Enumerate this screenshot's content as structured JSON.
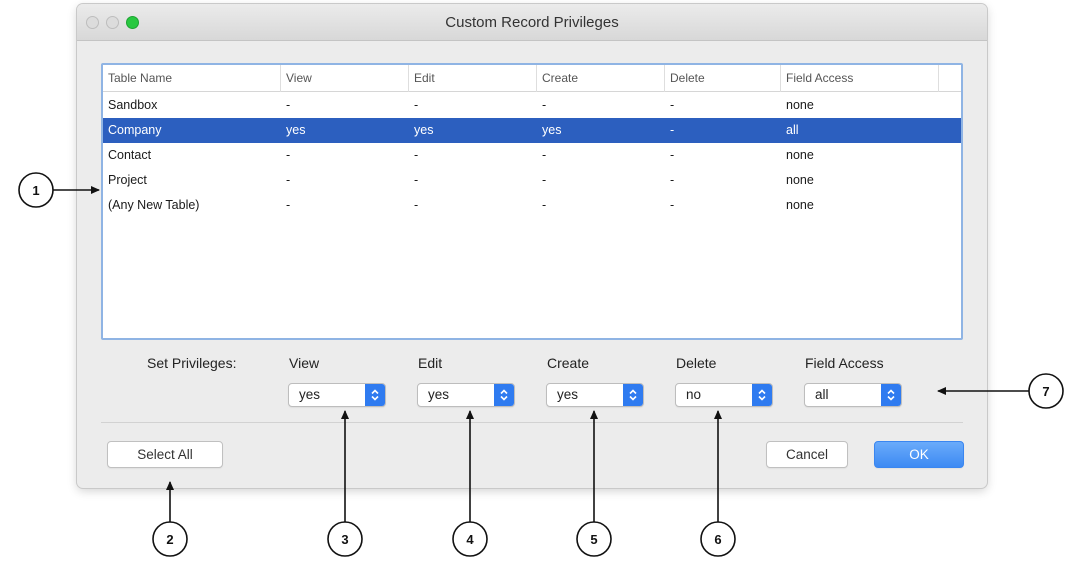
{
  "window": {
    "title": "Custom Record Privileges"
  },
  "table": {
    "columns": [
      "Table Name",
      "View",
      "Edit",
      "Create",
      "Delete",
      "Field Access"
    ],
    "rows": [
      {
        "cells": [
          "Sandbox",
          "-",
          "-",
          "-",
          "-",
          "none"
        ],
        "selected": false
      },
      {
        "cells": [
          "Company",
          "yes",
          "yes",
          "yes",
          "-",
          "all"
        ],
        "selected": true
      },
      {
        "cells": [
          "Contact",
          "-",
          "-",
          "-",
          "-",
          "none"
        ],
        "selected": false
      },
      {
        "cells": [
          "Project",
          "-",
          "-",
          "-",
          "-",
          "none"
        ],
        "selected": false
      },
      {
        "cells": [
          "(Any New Table)",
          "-",
          "-",
          "-",
          "-",
          "none"
        ],
        "selected": false
      }
    ],
    "selection_color": "#2c5fbf"
  },
  "set_privileges": {
    "label": "Set Privileges:",
    "view": {
      "label": "View",
      "value": "yes"
    },
    "edit": {
      "label": "Edit",
      "value": "yes"
    },
    "create": {
      "label": "Create",
      "value": "yes"
    },
    "delete": {
      "label": "Delete",
      "value": "no"
    },
    "field_access": {
      "label": "Field Access",
      "value": "all"
    }
  },
  "buttons": {
    "select_all": "Select All",
    "cancel": "Cancel",
    "ok": "OK"
  },
  "callouts": [
    "1",
    "2",
    "3",
    "4",
    "5",
    "6",
    "7"
  ],
  "accent_color": "#3d8af3"
}
